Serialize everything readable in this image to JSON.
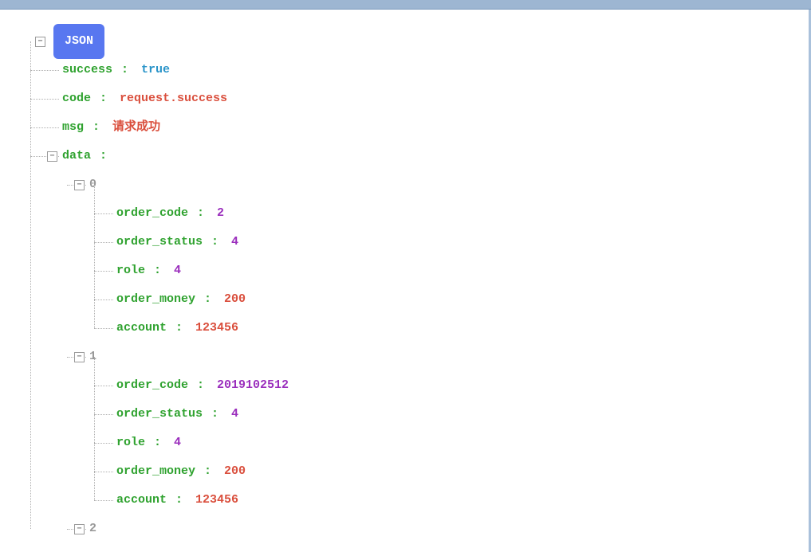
{
  "badge": "JSON",
  "toggles": {
    "minus": "⊟",
    "plus": "⊞"
  },
  "root": {
    "success_key": "success",
    "success_val": "true",
    "code_key": "code",
    "code_val": "request.success",
    "msg_key": "msg",
    "msg_val": "请求成功",
    "data_key": "data"
  },
  "data": [
    {
      "idx": "0",
      "order_code_key": "order_code",
      "order_code_val": "2",
      "order_status_key": "order_status",
      "order_status_val": "4",
      "role_key": "role",
      "role_val": "4",
      "order_money_key": "order_money",
      "order_money_val": "200",
      "account_key": "account",
      "account_val": "123456"
    },
    {
      "idx": "1",
      "order_code_key": "order_code",
      "order_code_val": "2019102512",
      "order_status_key": "order_status",
      "order_status_val": "4",
      "role_key": "role",
      "role_val": "4",
      "order_money_key": "order_money",
      "order_money_val": "200",
      "account_key": "account",
      "account_val": "123456"
    },
    {
      "idx": "2"
    }
  ]
}
